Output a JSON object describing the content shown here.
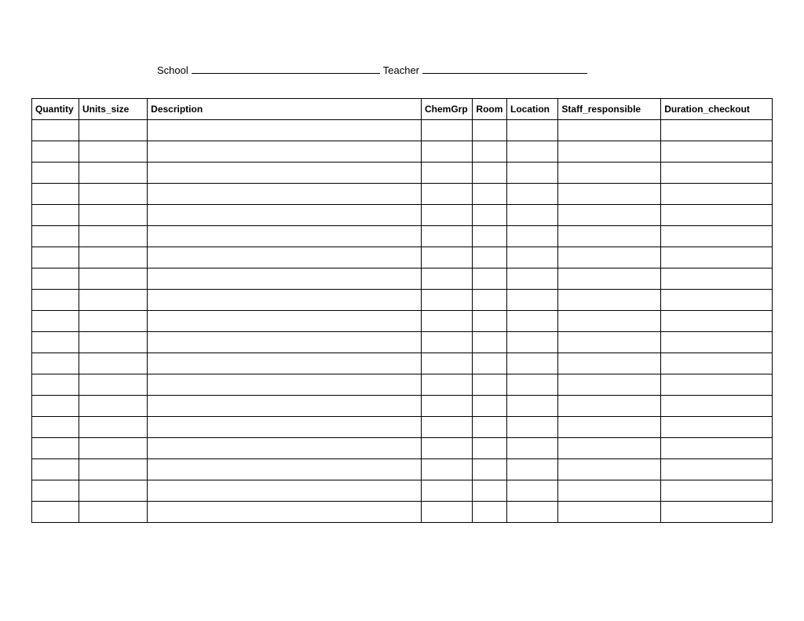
{
  "header": {
    "school_label": "School",
    "school_value": "",
    "teacher_label": "Teacher",
    "teacher_value": ""
  },
  "table": {
    "columns": [
      "Quantity",
      "Units_size",
      "Description",
      "ChemGrp",
      "Room",
      "Location",
      "Staff_responsible",
      "Duration_checkout"
    ],
    "rows": [
      [
        "",
        "",
        "",
        "",
        "",
        "",
        "",
        ""
      ],
      [
        "",
        "",
        "",
        "",
        "",
        "",
        "",
        ""
      ],
      [
        "",
        "",
        "",
        "",
        "",
        "",
        "",
        ""
      ],
      [
        "",
        "",
        "",
        "",
        "",
        "",
        "",
        ""
      ],
      [
        "",
        "",
        "",
        "",
        "",
        "",
        "",
        ""
      ],
      [
        "",
        "",
        "",
        "",
        "",
        "",
        "",
        ""
      ],
      [
        "",
        "",
        "",
        "",
        "",
        "",
        "",
        ""
      ],
      [
        "",
        "",
        "",
        "",
        "",
        "",
        "",
        ""
      ],
      [
        "",
        "",
        "",
        "",
        "",
        "",
        "",
        ""
      ],
      [
        "",
        "",
        "",
        "",
        "",
        "",
        "",
        ""
      ],
      [
        "",
        "",
        "",
        "",
        "",
        "",
        "",
        ""
      ],
      [
        "",
        "",
        "",
        "",
        "",
        "",
        "",
        ""
      ],
      [
        "",
        "",
        "",
        "",
        "",
        "",
        "",
        ""
      ],
      [
        "",
        "",
        "",
        "",
        "",
        "",
        "",
        ""
      ],
      [
        "",
        "",
        "",
        "",
        "",
        "",
        "",
        ""
      ],
      [
        "",
        "",
        "",
        "",
        "",
        "",
        "",
        ""
      ],
      [
        "",
        "",
        "",
        "",
        "",
        "",
        "",
        ""
      ],
      [
        "",
        "",
        "",
        "",
        "",
        "",
        "",
        ""
      ],
      [
        "",
        "",
        "",
        "",
        "",
        "",
        "",
        ""
      ]
    ]
  }
}
